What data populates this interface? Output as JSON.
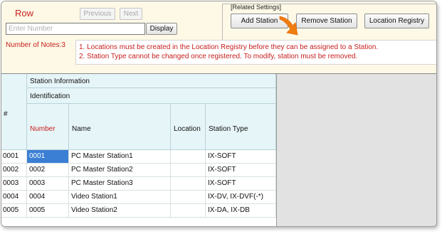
{
  "top_bar": {
    "title": "Row",
    "previous_label": "Previous",
    "next_label": "Next",
    "number_placeholder": "Enter Number",
    "number_value": "",
    "display_label": "Display"
  },
  "related_settings": {
    "label": "[Related Settings]",
    "add_station_label": "Add Station",
    "remove_station_label": "Remove Station",
    "location_registry_label": "Location Registry"
  },
  "notes": {
    "count_label": "Number of Notes:3",
    "items": [
      "1. Locations must be created in the Location Registry before they can be assigned to a Station.",
      "2. Station Type cannot be changed once registered. To modify, station must be removed."
    ]
  },
  "grid": {
    "row_header_label": "#",
    "group_label": "Station Information",
    "subgroup_label": "Identification",
    "columns": [
      "Number",
      "Name",
      "Location",
      "Station Type"
    ],
    "rows": [
      {
        "index": "0001",
        "number": "0001",
        "name": "PC Master Station1",
        "location": "",
        "type": "IX-SOFT"
      },
      {
        "index": "0002",
        "number": "0002",
        "name": "PC Master Station2",
        "location": "",
        "type": "IX-SOFT"
      },
      {
        "index": "0003",
        "number": "0003",
        "name": "PC Master Station3",
        "location": "",
        "type": "IX-SOFT"
      },
      {
        "index": "0004",
        "number": "0004",
        "name": "Video Station1",
        "location": "",
        "type": "IX-DV, IX-DVF(-*)"
      },
      {
        "index": "0005",
        "number": "0005",
        "name": "Video Station2",
        "location": "",
        "type": "IX-DA, IX-DB"
      }
    ]
  },
  "colors": {
    "accent_red": "#c81e1e",
    "header_bg": "#e6f5f8",
    "panel_bg": "#fdf9e6",
    "selection": "#3b7fd4",
    "pointer": "#f07d12"
  }
}
